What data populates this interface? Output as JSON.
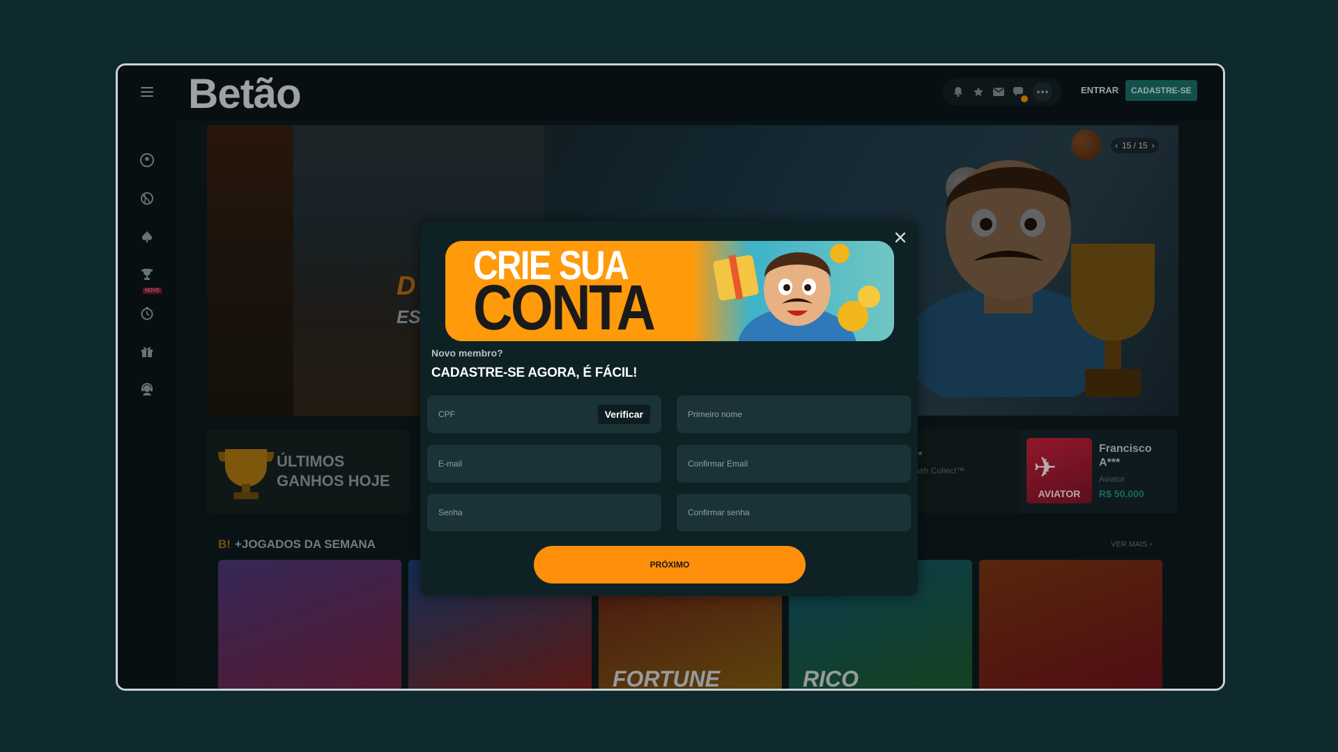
{
  "header": {
    "logo": "Betão",
    "login_label": "ENTRAR",
    "register_label": "CADASTRE-SE",
    "icons": [
      "bell-icon",
      "star-icon",
      "mail-icon",
      "chat-icon",
      "more-icon"
    ]
  },
  "sidebar": {
    "items": [
      {
        "name": "sports",
        "icon": "soccer-ball-icon"
      },
      {
        "name": "live",
        "icon": "live-sport-icon"
      },
      {
        "name": "casino",
        "icon": "spade-icon"
      },
      {
        "name": "tournaments",
        "icon": "trophy-icon"
      },
      {
        "name": "new",
        "icon": "timer-icon",
        "badge": "NOVO"
      },
      {
        "name": "promotions",
        "icon": "gift-icon"
      },
      {
        "name": "support",
        "icon": "support-icon"
      }
    ]
  },
  "banner": {
    "pager": "15 / 15",
    "text1": "D",
    "text2": "ES"
  },
  "wins": {
    "title_line1": "ÚLTIMOS",
    "title_line2": "GANHOS HOJE",
    "items": [
      {
        "name": "C***",
        "game": "r Cash Collect™"
      },
      {
        "name_line1": "Francisco",
        "name_line2": "A***",
        "game": "Aviator",
        "amount": "R$ 50.000",
        "thumb_label": "AVIATOR"
      }
    ]
  },
  "week": {
    "prefix": "B!",
    "title": "+JOGADOS DA SEMANA",
    "see_more": "VER MAIS",
    "games": [
      {
        "label": ""
      },
      {
        "label": ""
      },
      {
        "label": "FORTUNE"
      },
      {
        "label": "RICO"
      },
      {
        "label": ""
      }
    ]
  },
  "modal": {
    "promo_line1": "CRIE SUA",
    "promo_line2": "CONTA",
    "subtitle": "Novo membro?",
    "title": "CADASTRE-SE AGORA, É FÁCIL!",
    "fields": {
      "cpf": {
        "placeholder": "CPF",
        "value": ""
      },
      "first_name": {
        "placeholder": "Primeiro nome",
        "value": ""
      },
      "email": {
        "placeholder": "E-mail",
        "value": ""
      },
      "confirm_email": {
        "placeholder": "Confirmar Email",
        "value": ""
      },
      "password": {
        "placeholder": "Senha",
        "value": ""
      },
      "confirm_password": {
        "placeholder": "Confirmar senha",
        "value": ""
      }
    },
    "verify_label": "Verificar",
    "next_label": "PRÓXIMO"
  },
  "colors": {
    "accent": "#ff8f0a",
    "primary_button": "#1a6b62",
    "modal_bg": "#0e2125",
    "field_bg": "#1b3237"
  }
}
